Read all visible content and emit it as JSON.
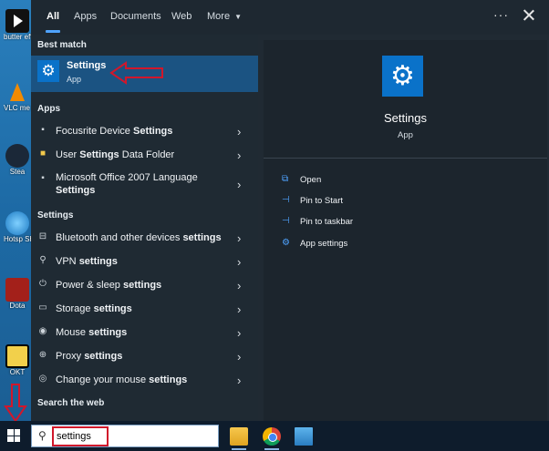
{
  "desktop": {
    "icons": [
      {
        "label": "butter effect.m"
      },
      {
        "label": "VLC me playe"
      },
      {
        "label": "Stea"
      },
      {
        "label": "Hotsp Shiel"
      },
      {
        "label": "Dota"
      },
      {
        "label": "OKT"
      }
    ]
  },
  "tabs": [
    "All",
    "Apps",
    "Documents",
    "Web",
    "More"
  ],
  "topbar": {
    "ellipsis": "···"
  },
  "best_match": {
    "header": "Best match",
    "name": "Settings",
    "sub": "App"
  },
  "apps": {
    "header": "Apps",
    "items": [
      {
        "pre": "Focusrite Device ",
        "bold": "Settings",
        "post": ""
      },
      {
        "pre": "User ",
        "bold": "Settings",
        "post": " Data Folder"
      },
      {
        "pre": "Microsoft Office 2007 Language",
        "bold": "Settings",
        "post": ""
      }
    ]
  },
  "settings": {
    "header": "Settings",
    "items": [
      {
        "pre": "Bluetooth and other devices ",
        "bold": "settings"
      },
      {
        "pre": "VPN ",
        "bold": "settings"
      },
      {
        "pre": "Power & sleep ",
        "bold": "settings"
      },
      {
        "pre": "Storage ",
        "bold": "settings"
      },
      {
        "pre": "Mouse ",
        "bold": "settings"
      },
      {
        "pre": "Proxy ",
        "bold": "settings"
      },
      {
        "pre": "Change your mouse ",
        "bold": "settings"
      }
    ]
  },
  "search_web": {
    "header": "Search the web"
  },
  "preview": {
    "title": "Settings",
    "sub": "App",
    "actions": [
      "Open",
      "Pin to Start",
      "Pin to taskbar",
      "App settings"
    ]
  },
  "search": {
    "value": "settings"
  },
  "colors": {
    "accent": "#0a72c9",
    "highlight": "#d1172b",
    "selected": "#1b5382"
  }
}
